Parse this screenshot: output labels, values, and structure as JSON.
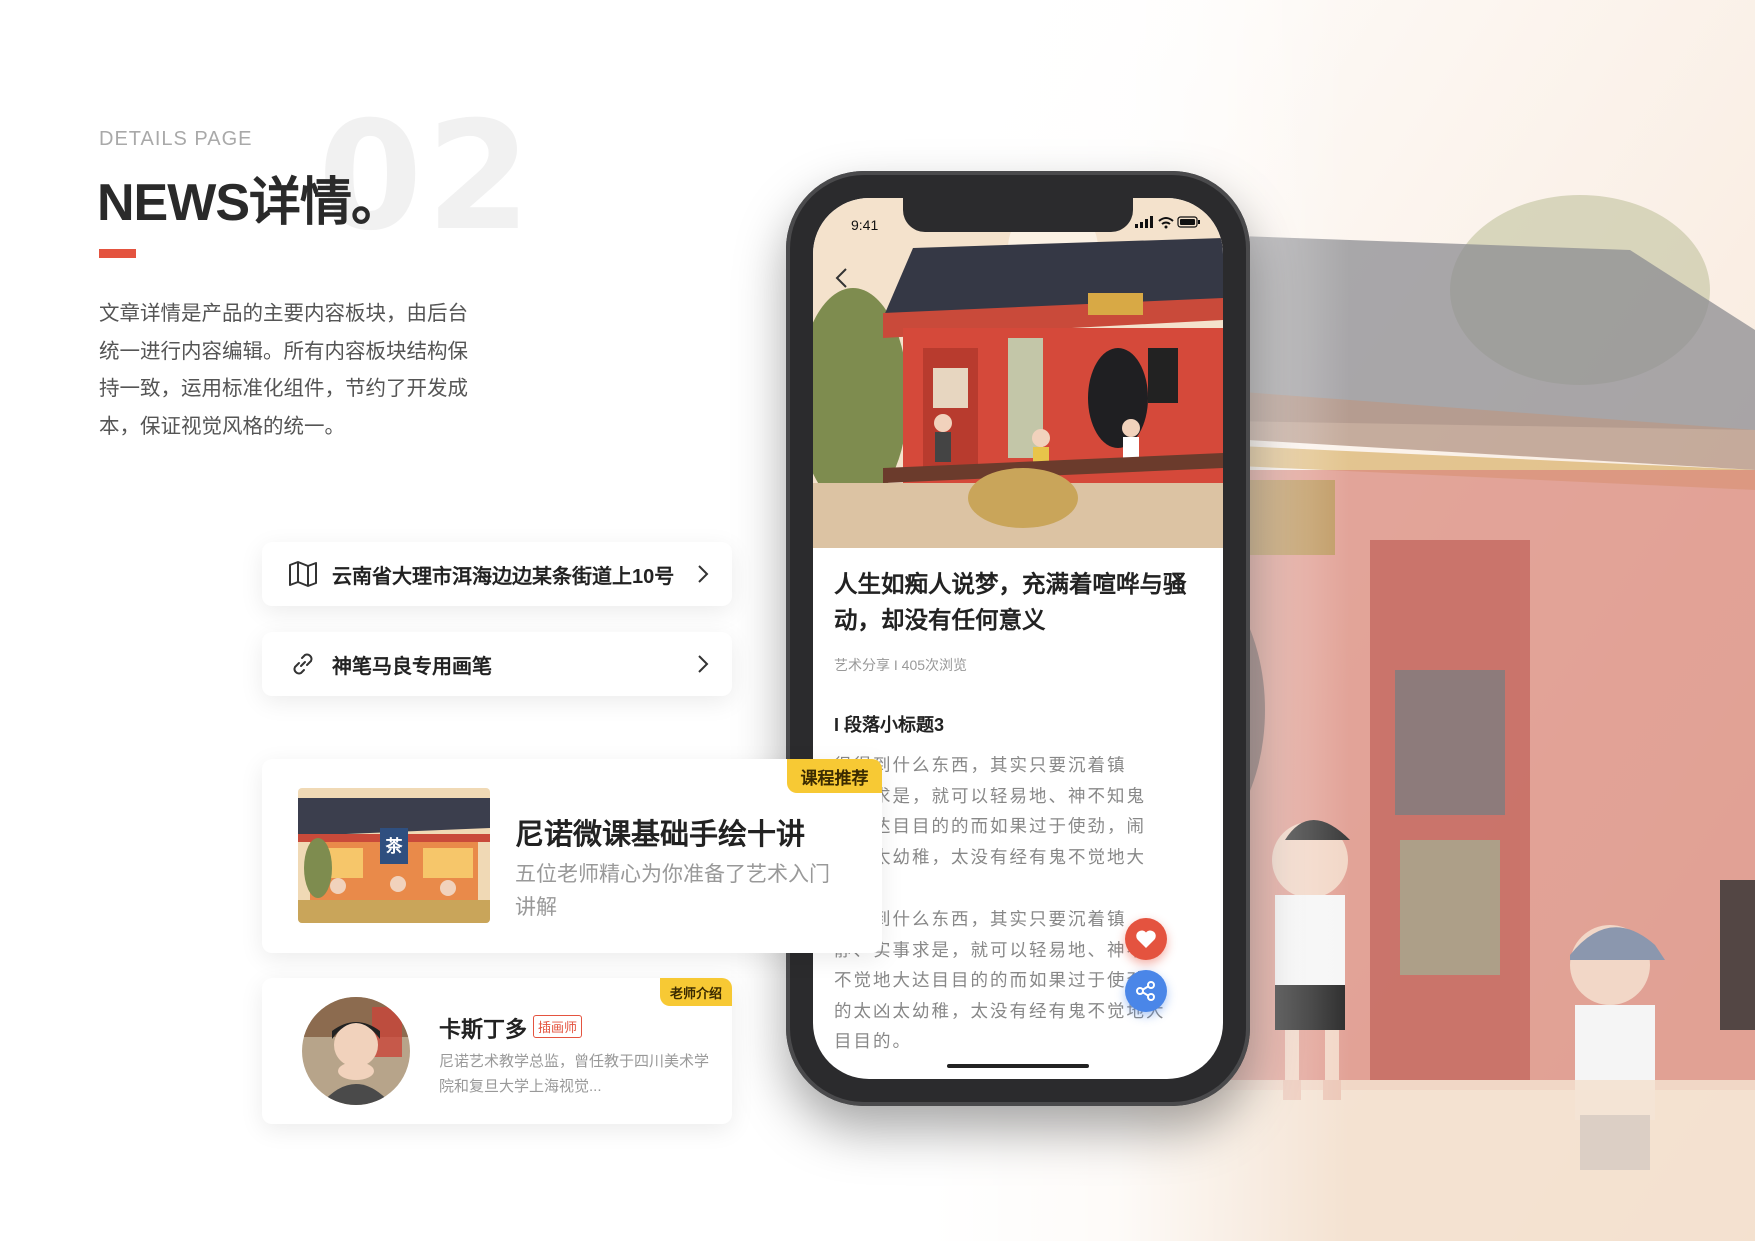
{
  "header": {
    "eyebrow": "DETAILS PAGE",
    "title": "NEWS详情。",
    "section_number": "02",
    "description": "文章详情是产品的主要内容板块，由后台统一进行内容编辑。所有内容板块结构保持一致，运用标准化组件，节约了开发成本，保证视觉风格的统一。"
  },
  "address_row": {
    "icon": "map-icon",
    "text": "云南省大理市洱海边边某条街道上10号"
  },
  "link_row": {
    "icon": "link-icon",
    "text": "神笔马良专用画笔"
  },
  "course_card": {
    "tag": "课程推荐",
    "title": "尼诺微课基础手绘十讲",
    "subtitle": "五位老师精心为你准备了艺术入门讲解",
    "thumb_sign": "茶"
  },
  "teacher_card": {
    "tag": "老师介绍",
    "name": "卡斯丁多",
    "badge": "插画师",
    "bio": "尼诺艺术教学总监，曾任教于四川美术学院和复旦大学上海视觉..."
  },
  "phone": {
    "status_time": "9:41",
    "article": {
      "title": "人生如痴人说梦，充满着喧哗与骚动，却没有任何意义",
      "meta": "艺术分享 I 405次浏览",
      "section_heading": "I 段落小标题3",
      "paragraph_1": "很得到什么东西，其实只要沉着镇\n实事求是，就可以轻易地、神不知鬼\n地大达目目的的而如果过于使劲，闹\n凶，太幼稚，太没有经有鬼不觉地大\n目的。",
      "paragraph_2": "很得到什么东西，其实只要沉着镇\n静、实事求是，就可以轻易地、神不\n不觉地大达目目的的而如果过于使劲\n的太凶太幼稚，太没有经有鬼不觉地大\n目目的。"
    },
    "fab_like_icon": "heart-icon",
    "fab_share_icon": "share-icon"
  },
  "colors": {
    "accent": "#e4533f",
    "tag_yellow": "#f7c934",
    "share_blue": "#4a86e8"
  }
}
